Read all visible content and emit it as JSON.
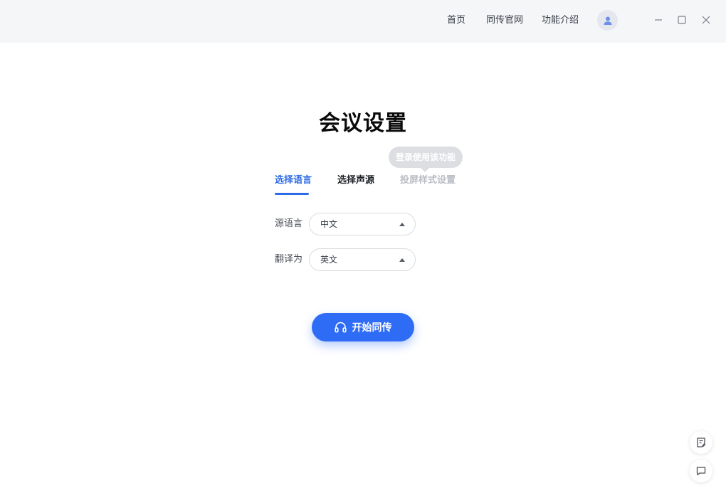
{
  "nav": {
    "links": [
      "首页",
      "同传官网",
      "功能介绍"
    ]
  },
  "page": {
    "title": "会议设置"
  },
  "tabs": [
    "选择语言",
    "选择声源",
    "投屏样式设置"
  ],
  "tooltip": "登录使用该功能",
  "form": {
    "source_label": "源语言",
    "source_value": "中文",
    "target_label": "翻译为",
    "target_value": "英文"
  },
  "actions": {
    "start_label": "开始同传"
  },
  "icons": {
    "avatar": "user-avatar-icon",
    "minimize": "minimize-icon",
    "maximize": "maximize-icon",
    "close": "close-icon",
    "headphones": "headphones-icon",
    "feedback": "feedback-note-icon",
    "chat": "chat-bubble-icon"
  },
  "colors": {
    "accent": "#2f6cf6",
    "topbar": "#f5f6f8",
    "disabled_tab": "#b8bcc4"
  }
}
